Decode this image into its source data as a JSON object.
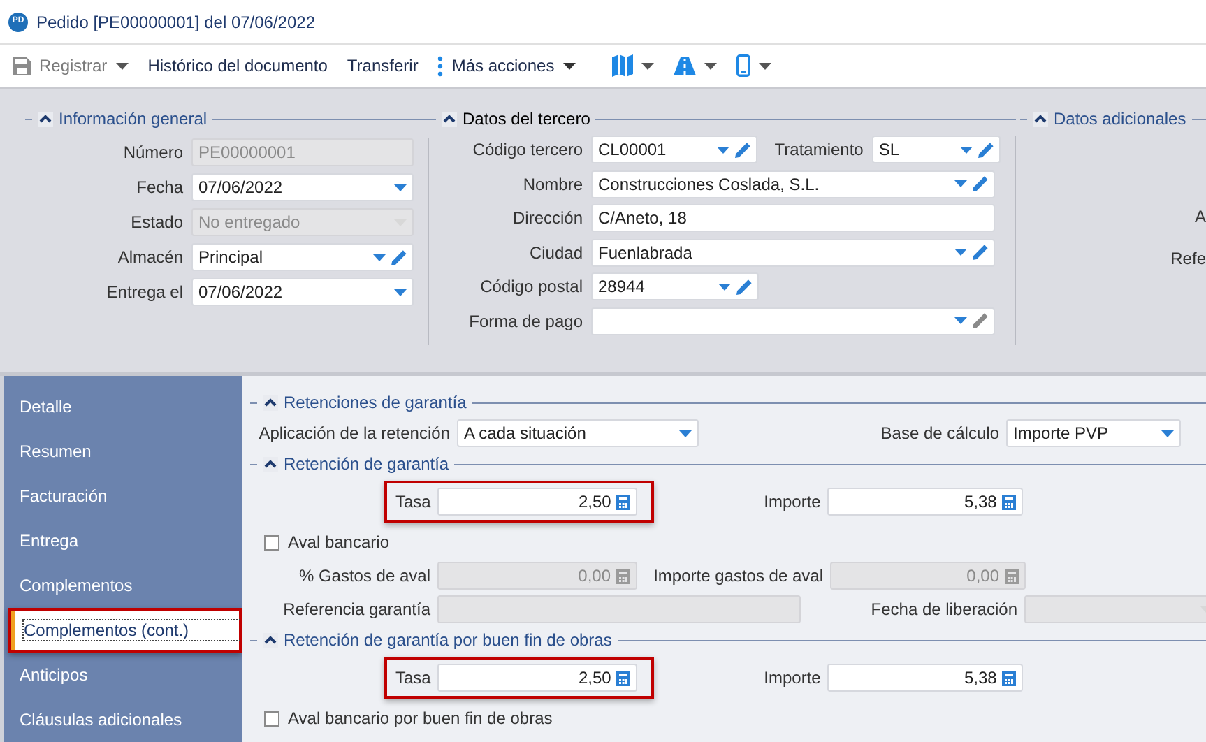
{
  "window": {
    "icon_text": "PD",
    "title": "Pedido [PE00000001] del 07/06/2022"
  },
  "toolbar": [
    {
      "kind": "save",
      "label": "Registrar",
      "disabled": true
    },
    {
      "kind": "text",
      "label": "Histórico del documento",
      "disabled": false
    },
    {
      "kind": "text",
      "label": "Transferir",
      "disabled": false
    },
    {
      "kind": "more",
      "label": "Más acciones",
      "disabled": false
    },
    {
      "kind": "map"
    },
    {
      "kind": "road"
    },
    {
      "kind": "phone"
    }
  ],
  "header": {
    "sections": [
      {
        "title": "Información general",
        "expanded": true,
        "focused": false,
        "rows": [
          {
            "fields": [
              {
                "label": "Número",
                "kind": "text",
                "value": "PE00000001",
                "disabled": true
              }
            ]
          },
          {
            "fields": [
              {
                "label": "Fecha",
                "kind": "date",
                "value": "07/06/2022",
                "disabled": false
              }
            ]
          },
          {
            "fields": [
              {
                "label": "Estado",
                "kind": "select",
                "value": "No entregado",
                "disabled": true
              }
            ]
          },
          {
            "fields": [
              {
                "label": "Almacén",
                "kind": "select-edit",
                "value": "Principal",
                "disabled": false
              }
            ]
          },
          {
            "fields": [
              {
                "label": "Entrega el",
                "kind": "date",
                "value": "07/06/2022",
                "disabled": false
              }
            ]
          }
        ]
      },
      {
        "title": "Datos del tercero",
        "expanded": true,
        "focused": true,
        "rows": [
          {
            "fields": [
              {
                "label": "Código tercero",
                "kind": "select-edit",
                "value": "CL00001",
                "disabled": false
              },
              {
                "label": "Tratamiento",
                "kind": "select-edit",
                "value": "SL",
                "disabled": false
              }
            ]
          },
          {
            "fields": [
              {
                "label": "Nombre",
                "kind": "select-edit",
                "value": "Construcciones Coslada, S.L.",
                "disabled": false
              }
            ]
          },
          {
            "fields": [
              {
                "label": "Dirección",
                "kind": "text",
                "value": "C/Aneto, 18",
                "disabled": false
              }
            ]
          },
          {
            "fields": [
              {
                "label": "Ciudad",
                "kind": "select-edit",
                "value": "Fuenlabrada",
                "disabled": false
              }
            ]
          },
          {
            "fields": [
              {
                "label": "Código postal",
                "kind": "select-edit",
                "value": "28944",
                "disabled": false
              }
            ]
          },
          {
            "fields": [
              {
                "label": "Forma de pago",
                "kind": "select-edit",
                "disabled": false
              }
            ]
          }
        ]
      },
      {
        "title": "Datos adicionales",
        "expanded": true,
        "focused": false,
        "labels": [
          "A",
          "Refe"
        ]
      }
    ]
  },
  "sidebar": {
    "items": [
      {
        "label": "Detalle",
        "selected": false,
        "highlighted": false
      },
      {
        "label": "Resumen",
        "selected": false,
        "highlighted": false
      },
      {
        "label": "Facturación",
        "selected": false,
        "highlighted": false
      },
      {
        "label": "Entrega",
        "selected": false,
        "highlighted": false
      },
      {
        "label": "Complementos",
        "selected": false,
        "highlighted": false
      },
      {
        "label": "Complementos (cont.)",
        "selected": true,
        "highlighted": true
      },
      {
        "label": "Anticipos",
        "selected": false,
        "highlighted": false
      },
      {
        "label": "Cláusulas adicionales",
        "selected": false,
        "highlighted": false
      }
    ]
  },
  "content": {
    "sections": [
      {
        "title": "Retenciones de garantía",
        "expanded": true,
        "rows": [
          {
            "kind": "pair",
            "highlighted": false,
            "fields": [
              {
                "label": "Aplicación de la retención",
                "kind": "select",
                "value": "A cada situación",
                "disabled": false
              },
              {
                "label": "Base de cálculo",
                "kind": "select",
                "value": "Importe PVP",
                "disabled": false
              }
            ]
          }
        ]
      },
      {
        "title": "Retención de garantía",
        "expanded": true,
        "rows": [
          {
            "kind": "pair",
            "highlighted": true,
            "fields": [
              {
                "label": "Tasa",
                "kind": "number",
                "value": "2,50",
                "disabled": false
              },
              {
                "label": "Importe",
                "kind": "number",
                "value": "5,38",
                "disabled": false
              }
            ]
          },
          {
            "kind": "checkbox",
            "label": "Aval bancario",
            "checked": false
          },
          {
            "kind": "pair",
            "highlighted": false,
            "fields": [
              {
                "label": "% Gastos de aval",
                "kind": "number",
                "value": "0,00",
                "disabled": true
              },
              {
                "label": "Importe gastos de aval",
                "kind": "number",
                "value": "0,00",
                "disabled": true
              }
            ]
          },
          {
            "kind": "pair",
            "highlighted": false,
            "fields": [
              {
                "label": "Referencia garantía",
                "kind": "wide",
                "disabled": true
              },
              {
                "label": "Fecha de liberación",
                "kind": "date",
                "disabled": true
              }
            ]
          }
        ]
      },
      {
        "title": "Retención de garantía por buen fin de obras",
        "expanded": true,
        "rows": [
          {
            "kind": "pair",
            "highlighted": true,
            "fields": [
              {
                "label": "Tasa",
                "kind": "number",
                "value": "2,50",
                "disabled": false
              },
              {
                "label": "Importe",
                "kind": "number",
                "value": "5,38",
                "disabled": false
              }
            ]
          },
          {
            "kind": "checkbox",
            "label": "Aval bancario por buen fin de obras",
            "checked": false
          }
        ]
      }
    ]
  }
}
